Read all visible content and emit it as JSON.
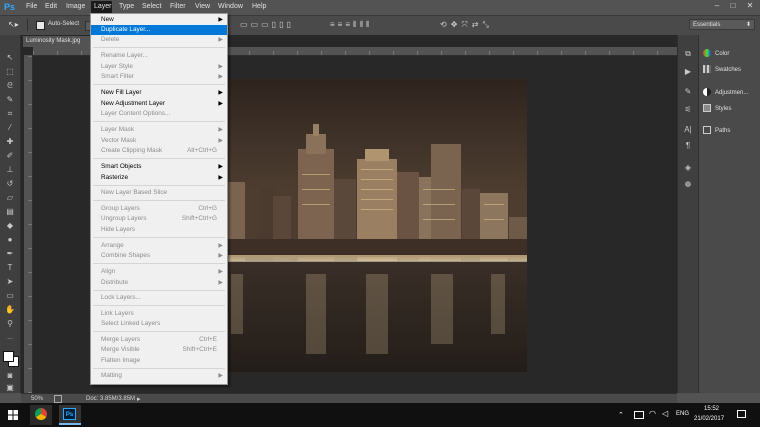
{
  "app": {
    "logo": "Ps"
  },
  "menubar": {
    "items": [
      "File",
      "Edit",
      "Image",
      "Layer",
      "Type",
      "Select",
      "Filter",
      "View",
      "Window",
      "Help"
    ]
  },
  "window_controls": {
    "minimize": "–",
    "maximize": "□",
    "close": "✕"
  },
  "options_bar": {
    "auto_select_label": "Auto-Select",
    "workspace": "Essentials"
  },
  "document": {
    "tab_title": "Luminosity Mask.jpg",
    "zoom": "50%",
    "doc_info": "Doc: 3.85M/3.85M"
  },
  "panels": {
    "items": [
      "Color",
      "Swatches",
      "Adjustmen...",
      "Styles",
      "Paths"
    ]
  },
  "layer_menu": {
    "items": [
      {
        "label": "New",
        "shortcut": "",
        "submenu": true,
        "disabled": false
      },
      {
        "label": "Duplicate Layer...",
        "shortcut": "",
        "submenu": false,
        "disabled": false,
        "highlighted": true
      },
      {
        "label": "Delete",
        "shortcut": "",
        "submenu": true,
        "disabled": true
      },
      {
        "label": "Rename Layer...",
        "shortcut": "",
        "submenu": false,
        "disabled": true
      },
      {
        "label": "Layer Style",
        "shortcut": "",
        "submenu": true,
        "disabled": true
      },
      {
        "label": "Smart Filter",
        "shortcut": "",
        "submenu": true,
        "disabled": true
      },
      {
        "label": "New Fill Layer",
        "shortcut": "",
        "submenu": true,
        "disabled": false
      },
      {
        "label": "New Adjustment Layer",
        "shortcut": "",
        "submenu": true,
        "disabled": false
      },
      {
        "label": "Layer Content Options...",
        "shortcut": "",
        "submenu": false,
        "disabled": true
      },
      {
        "label": "Layer Mask",
        "shortcut": "",
        "submenu": true,
        "disabled": true
      },
      {
        "label": "Vector Mask",
        "shortcut": "",
        "submenu": true,
        "disabled": true
      },
      {
        "label": "Create Clipping Mask",
        "shortcut": "Alt+Ctrl+G",
        "submenu": false,
        "disabled": true
      },
      {
        "label": "Smart Objects",
        "shortcut": "",
        "submenu": true,
        "disabled": false
      },
      {
        "label": "Rasterize",
        "shortcut": "",
        "submenu": true,
        "disabled": false
      },
      {
        "label": "New Layer Based Slice",
        "shortcut": "",
        "submenu": false,
        "disabled": true
      },
      {
        "label": "Group Layers",
        "shortcut": "Ctrl+G",
        "submenu": false,
        "disabled": true
      },
      {
        "label": "Ungroup Layers",
        "shortcut": "Shift+Ctrl+G",
        "submenu": false,
        "disabled": true
      },
      {
        "label": "Hide Layers",
        "shortcut": "",
        "submenu": false,
        "disabled": true
      },
      {
        "label": "Arrange",
        "shortcut": "",
        "submenu": true,
        "disabled": true
      },
      {
        "label": "Combine Shapes",
        "shortcut": "",
        "submenu": true,
        "disabled": true
      },
      {
        "label": "Align",
        "shortcut": "",
        "submenu": true,
        "disabled": true
      },
      {
        "label": "Distribute",
        "shortcut": "",
        "submenu": true,
        "disabled": true
      },
      {
        "label": "Lock Layers...",
        "shortcut": "",
        "submenu": false,
        "disabled": true
      },
      {
        "label": "Link Layers",
        "shortcut": "",
        "submenu": false,
        "disabled": true
      },
      {
        "label": "Select Linked Layers",
        "shortcut": "",
        "submenu": false,
        "disabled": true
      },
      {
        "label": "Merge Layers",
        "shortcut": "Ctrl+E",
        "submenu": false,
        "disabled": true
      },
      {
        "label": "Merge Visible",
        "shortcut": "Shift+Ctrl+E",
        "submenu": false,
        "disabled": true
      },
      {
        "label": "Flatten Image",
        "shortcut": "",
        "submenu": false,
        "disabled": true
      },
      {
        "label": "Matting",
        "shortcut": "",
        "submenu": true,
        "disabled": true
      }
    ]
  },
  "taskbar": {
    "language": "ENG",
    "time": "15:52",
    "date": "21/02/2017"
  },
  "colors": {
    "menu_highlight": "#0078d7",
    "ui_dark": "#535353",
    "canvas_bg": "#282828"
  }
}
